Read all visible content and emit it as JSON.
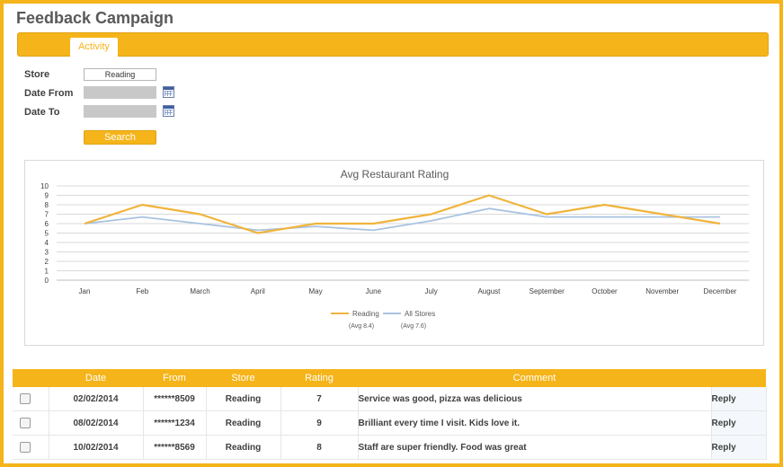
{
  "page": {
    "title": "Feedback Campaign"
  },
  "tabs": [
    {
      "label": "Activity"
    }
  ],
  "form": {
    "store_label": "Store",
    "store_value": "Reading",
    "date_from_label": "Date From",
    "date_from_value": "",
    "date_to_label": "Date To",
    "date_to_value": "",
    "search_label": "Search"
  },
  "colors": {
    "accent": "#f5b41a",
    "reading_line": "#f0b43c",
    "all_stores_line": "#a9c3e0",
    "reply_link": "#3d86c6"
  },
  "chart_data": {
    "type": "line",
    "title": "Avg Restaurant Rating",
    "categories": [
      "Jan",
      "Feb",
      "March",
      "April",
      "May",
      "June",
      "July",
      "August",
      "September",
      "October",
      "November",
      "December"
    ],
    "y_ticks": [
      "0",
      "1",
      "2",
      "3",
      "4",
      "5",
      "6",
      "7",
      "8",
      "9",
      "10"
    ],
    "ylim": [
      0,
      10
    ],
    "grid": true,
    "legend_position": "bottom",
    "series": [
      {
        "name": "Reading",
        "avg_label": "(Avg 8.4)",
        "values": [
          6,
          8,
          7,
          5,
          6,
          6,
          7,
          9,
          7,
          8,
          7,
          6
        ]
      },
      {
        "name": "All Stores",
        "avg_label": "(Avg 7.6)",
        "values": [
          6,
          6.7,
          6,
          5.3,
          5.7,
          5.3,
          6.3,
          7.6,
          6.7,
          6.7,
          6.7,
          6.7
        ]
      }
    ]
  },
  "table": {
    "headers": [
      "",
      "Date",
      "From",
      "Store",
      "Rating",
      "Comment",
      ""
    ],
    "rows": [
      {
        "date": "02/02/2014",
        "from": "******8509",
        "store": "Reading",
        "rating": "7",
        "comment": "Service was good, pizza was delicious",
        "action": "Reply"
      },
      {
        "date": "08/02/2014",
        "from": "******1234",
        "store": "Reading",
        "rating": "9",
        "comment": "Brilliant every time I visit. Kids love it.",
        "action": "Reply"
      },
      {
        "date": "10/02/2014",
        "from": "******8569",
        "store": "Reading",
        "rating": "8",
        "comment": "Staff are super friendly. Food was great",
        "action": "Reply"
      }
    ]
  }
}
